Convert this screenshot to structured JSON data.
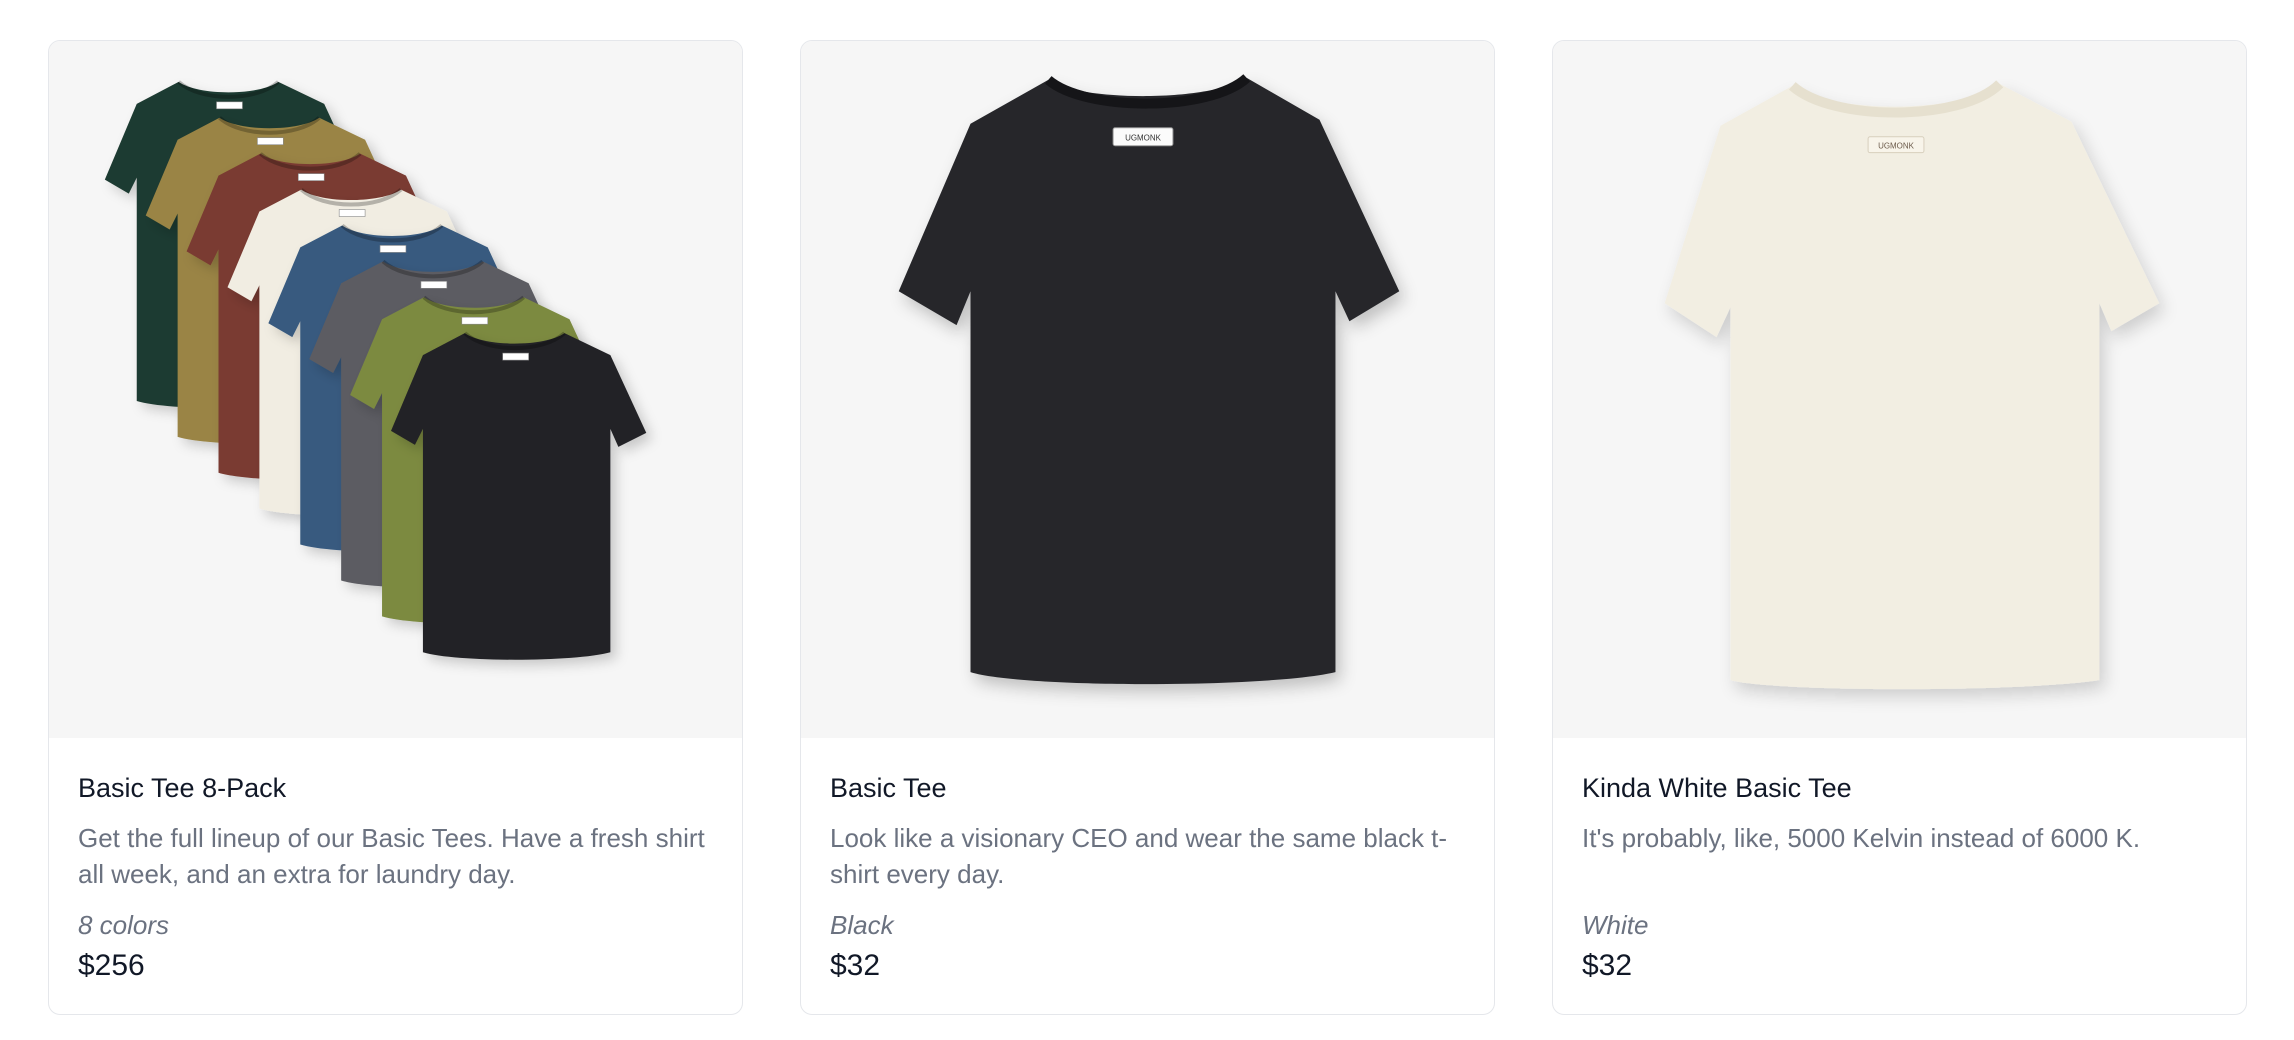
{
  "products": [
    {
      "name": "Basic Tee 8-Pack",
      "description": "Get the full lineup of our Basic Tees. Have a fresh shirt all week, and an extra for laundry day.",
      "options": "8 colors",
      "price": "$256",
      "image": "stack-of-eight-tees",
      "colors": [
        "#1f3a30",
        "#9a8445",
        "#7a3a31",
        "#f1ede2",
        "#375a7f",
        "#5b5c62",
        "#7b8a41",
        "#222225"
      ]
    },
    {
      "name": "Basic Tee",
      "description": "Look like a visionary CEO and wear the same black t-shirt every day.",
      "options": "Black",
      "price": "$32",
      "image": "black-tee",
      "colors": [
        "#25262a"
      ],
      "tag_text": "UGMONK"
    },
    {
      "name": "Kinda White Basic Tee",
      "description": "It's probably, like, 5000 Kelvin instead of 6000 K.",
      "options": "White",
      "price": "$32",
      "image": "off-white-tee",
      "colors": [
        "#f2eee2"
      ],
      "tag_text": "UGMONK"
    }
  ]
}
